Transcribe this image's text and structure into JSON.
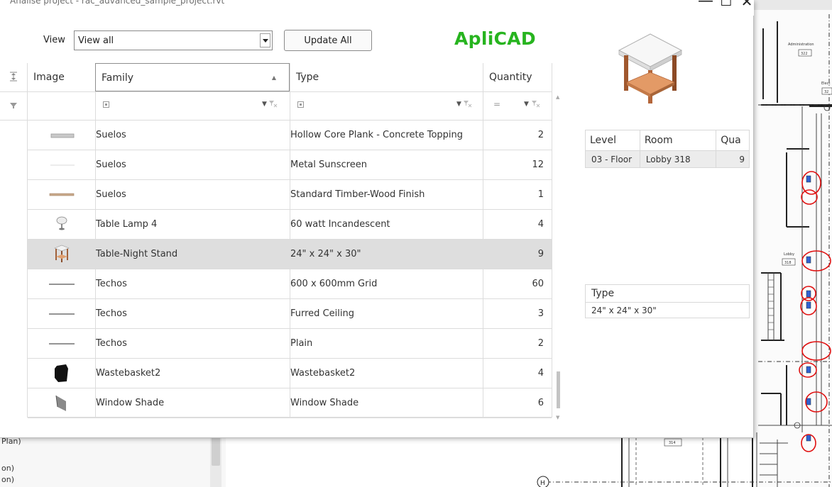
{
  "window": {
    "title": "Analise project - rac_advanced_sample_project.rvt",
    "minimize": "—",
    "maximize": "☐",
    "close": "✕"
  },
  "toolbar": {
    "view_label": "View",
    "view_value": "View all",
    "update_label": "Update All",
    "brand": "ApliCAD"
  },
  "grid": {
    "columns": [
      {
        "key": "image",
        "label": "Image"
      },
      {
        "key": "family",
        "label": "Family"
      },
      {
        "key": "type",
        "label": "Type"
      },
      {
        "key": "quantity",
        "label": "Quantity"
      }
    ],
    "rows": [
      {
        "icon": "floor-slab-icon",
        "family": "Suelos",
        "type": "Hollow Core Plank - Concrete Topping",
        "quantity": "2"
      },
      {
        "icon": "floor-thin-icon",
        "family": "Suelos",
        "type": "Metal Sunscreen",
        "quantity": "12"
      },
      {
        "icon": "floor-wood-icon",
        "family": "Suelos",
        "type": "Standard Timber-Wood Finish",
        "quantity": "1"
      },
      {
        "icon": "table-lamp-icon",
        "family": "Table Lamp 4",
        "type": "60 watt Incandescent",
        "quantity": "4"
      },
      {
        "icon": "night-stand-icon",
        "family": "Table-Night Stand",
        "type": "24\" x 24\" x 30\"",
        "quantity": "9",
        "selected": true
      },
      {
        "icon": "ceiling-line-icon",
        "family": "Techos",
        "type": "600 x 600mm Grid",
        "quantity": "60"
      },
      {
        "icon": "ceiling-line-icon",
        "family": "Techos",
        "type": "Furred Ceiling",
        "quantity": "3"
      },
      {
        "icon": "ceiling-line-icon",
        "family": "Techos",
        "type": "Plain",
        "quantity": "2"
      },
      {
        "icon": "wastebasket-icon",
        "family": "Wastebasket2",
        "type": "Wastebasket2",
        "quantity": "4"
      },
      {
        "icon": "window-shade-icon",
        "family": "Window Shade",
        "type": "Window Shade",
        "quantity": "6"
      }
    ]
  },
  "location": {
    "headers": [
      "Level",
      "Room",
      "Qua"
    ],
    "rows": [
      {
        "level": "03 - Floor",
        "room": "Lobby 318",
        "qty": "9"
      }
    ]
  },
  "type_panel": {
    "header": "Type",
    "value": "24\" x 24\" x 30\""
  },
  "host": {
    "plan_labels": [
      "Administration",
      "322",
      "Elect",
      "32",
      "Lobby",
      "318",
      "314",
      "H"
    ],
    "left_items": [
      "Plan)",
      "on)",
      "on)"
    ]
  },
  "colors": {
    "brand": "#27b41f",
    "selected_row": "#dedede",
    "markup_red": "#e01010",
    "door_blue": "#3060d0"
  }
}
